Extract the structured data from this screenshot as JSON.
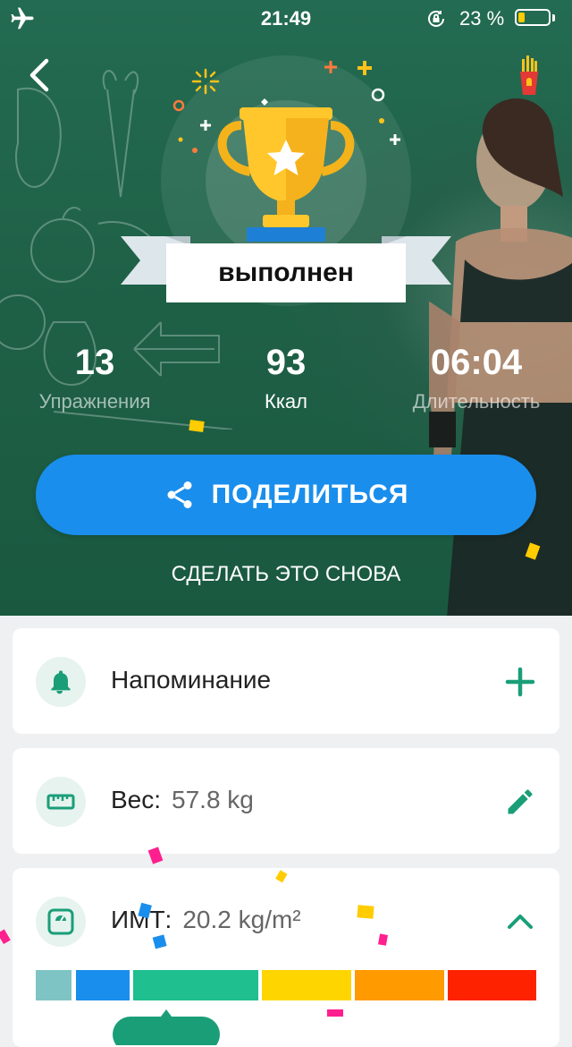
{
  "status_bar": {
    "time": "21:49",
    "battery_percent": "23 %",
    "battery_level": 0.23,
    "battery_color": "#ffcc00"
  },
  "hero": {
    "badge_label": "выполнен",
    "stats": [
      {
        "value": "13",
        "label": "Упражнения"
      },
      {
        "value": "93",
        "label": "Ккал"
      },
      {
        "value": "06:04",
        "label": "Длительность"
      }
    ],
    "share_label": "ПОДЕЛИТЬСЯ",
    "again_label": "СДЕЛАТЬ ЭТО СНОВА",
    "icons": {
      "back": "back-chevron-icon",
      "corner": "fries-icon",
      "share": "share-icon",
      "trophy": "trophy-icon"
    }
  },
  "cards": {
    "reminder": {
      "title": "Напоминание",
      "icon": "bell-icon",
      "action_icon": "plus-icon"
    },
    "weight": {
      "label": "Вес:",
      "value": "57.8 kg",
      "icon": "ruler-icon",
      "action_icon": "pencil-icon"
    },
    "bmi": {
      "label": "ИМТ:",
      "value": "20.2 kg/m²",
      "icon": "scale-icon",
      "action_icon": "chevron-up-icon"
    }
  },
  "bmi_scale_colors": [
    "#7ec4c4",
    "#1a8eec",
    "#1fbf8f",
    "#ffd500",
    "#ff9a00",
    "#ff2200"
  ],
  "colors": {
    "accent_green": "#1a9e78",
    "share_blue": "#1a8eec",
    "hero_green": "#1f6649"
  }
}
